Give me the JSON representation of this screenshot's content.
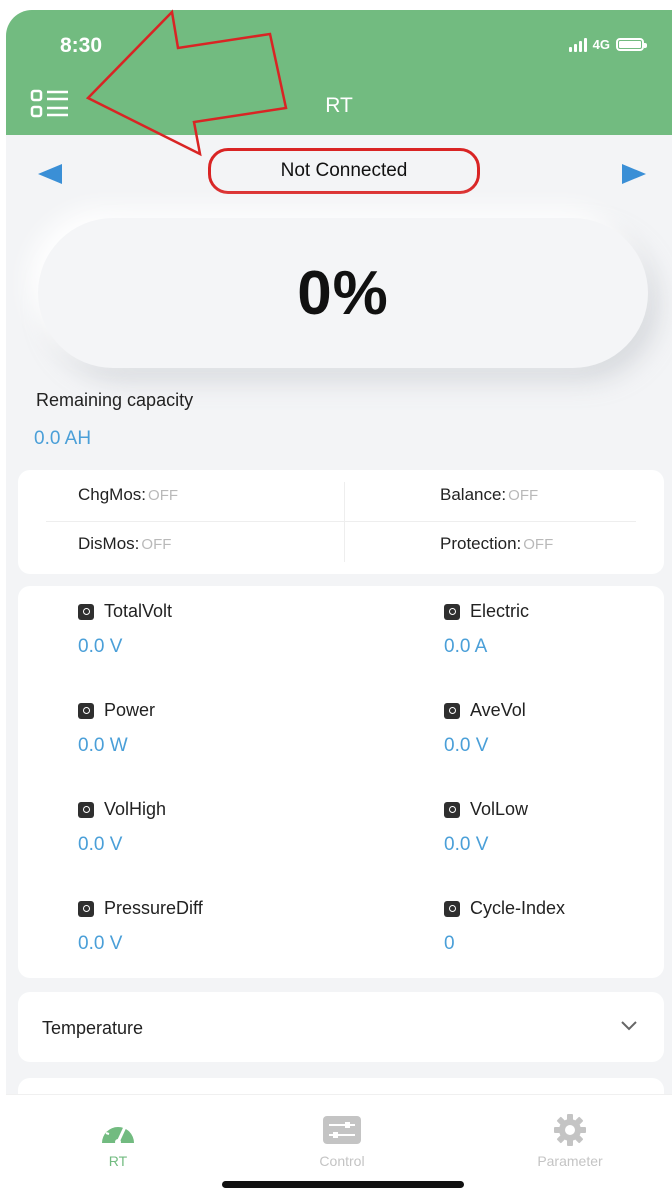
{
  "status_bar": {
    "time": "8:30",
    "network": "4G"
  },
  "header": {
    "title": "RT"
  },
  "connection": {
    "status": "Not Connected"
  },
  "soc": {
    "value": "0%"
  },
  "capacity": {
    "label": "Remaining capacity",
    "value": "0.0 AH"
  },
  "mos": {
    "chg": {
      "label": "ChgMos:",
      "value": "OFF"
    },
    "balance": {
      "label": "Balance:",
      "value": "OFF"
    },
    "dis": {
      "label": "DisMos:",
      "value": "OFF"
    },
    "protection": {
      "label": "Protection:",
      "value": "OFF"
    }
  },
  "metrics": [
    {
      "label": "TotalVolt",
      "value": "0.0 V"
    },
    {
      "label": "Electric",
      "value": "0.0 A"
    },
    {
      "label": "Power",
      "value": "0.0 W"
    },
    {
      "label": "AveVol",
      "value": "0.0 V"
    },
    {
      "label": "VolHigh",
      "value": "0.0 V"
    },
    {
      "label": "VolLow",
      "value": "0.0 V"
    },
    {
      "label": "PressureDiff",
      "value": "0.0 V"
    },
    {
      "label": "Cycle-Index",
      "value": "0"
    }
  ],
  "temperature": {
    "label": "Temperature"
  },
  "tabs": [
    {
      "label": "RT",
      "icon": "gauge-icon",
      "active": true
    },
    {
      "label": "Control",
      "icon": "sliders-icon",
      "active": false
    },
    {
      "label": "Parameter",
      "icon": "gear-icon",
      "active": false
    }
  ],
  "colors": {
    "header": "#72bb80",
    "accent_value": "#4a9fd8",
    "annotation_red": "#d92424",
    "tab_active": "#72bb80",
    "tab_inactive": "#c4c4c4"
  }
}
